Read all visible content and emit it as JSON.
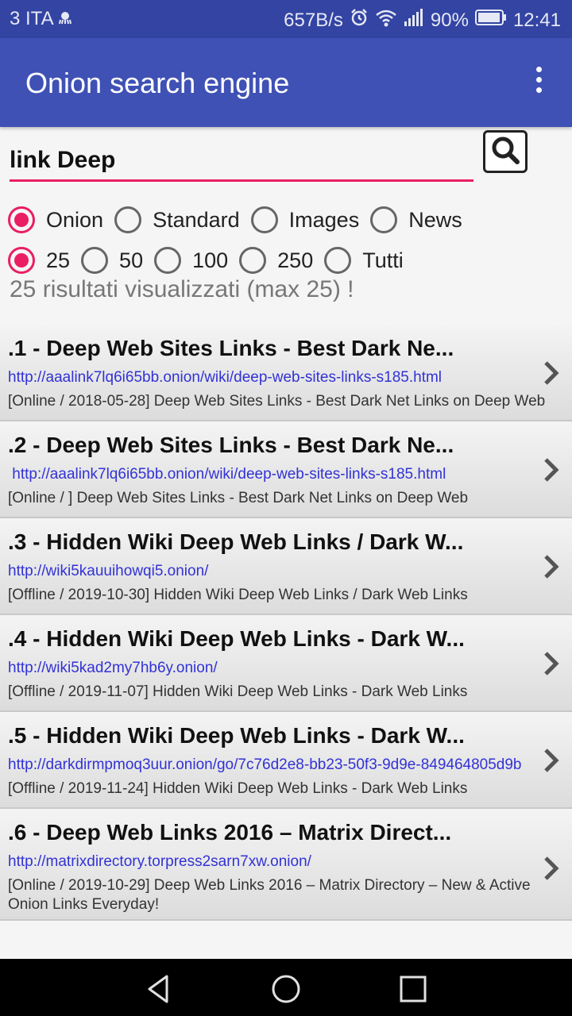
{
  "status_bar": {
    "carrier": "3 ITA",
    "speed": "657B/s",
    "battery": "90%",
    "time": "12:41",
    "icons": [
      "octopus-icon",
      "alarm-icon",
      "wifi-icon",
      "signal-icon",
      "battery-icon"
    ]
  },
  "app_bar": {
    "title": "Onion search engine",
    "menu_icon": "overflow-menu-icon"
  },
  "search": {
    "value": "link Deep",
    "button_icon": "search-icon"
  },
  "engine_options": {
    "items": [
      "Onion",
      "Standard",
      "Images",
      "News"
    ],
    "selected": "Onion"
  },
  "count_options": {
    "items": [
      "25",
      "50",
      "100",
      "250",
      "Tutti"
    ],
    "selected": "25"
  },
  "status_text": "25 risultati visualizzati (max 25) !",
  "results": [
    {
      "title": ".1 - Deep Web Sites Links - Best Dark Ne...",
      "url": "http://aaalink7lq6i65bb.onion/wiki/deep-web-sites-links-s185.html",
      "desc": "[Online / 2018-05-28] Deep Web Sites Links - Best Dark Net Links on Deep Web"
    },
    {
      "title": ".2 - Deep Web Sites Links - Best Dark Ne...",
      "url": " http://aaalink7lq6i65bb.onion/wiki/deep-web-sites-links-s185.html",
      "desc": "[Online / ] Deep Web Sites Links - Best Dark Net Links on Deep Web"
    },
    {
      "title": ".3 - Hidden Wiki Deep Web Links / Dark W...",
      "url": "http://wiki5kauuihowqi5.onion/",
      "desc": "[Offline / 2019-10-30] Hidden Wiki Deep Web Links / Dark Web Links"
    },
    {
      "title": ".4 - Hidden Wiki Deep Web Links - Dark W...",
      "url": "http://wiki5kad2my7hb6y.onion/",
      "desc": "[Offline / 2019-11-07] Hidden Wiki Deep Web Links - Dark Web Links"
    },
    {
      "title": ".5 - Hidden Wiki Deep Web Links - Dark W...",
      "url": "http://darkdirmpmoq3uur.onion/go/7c76d2e8-bb23-50f3-9d9e-849464805d9b",
      "desc": "[Offline / 2019-11-24] Hidden Wiki Deep Web Links - Dark Web Links"
    },
    {
      "title": ".6 - Deep Web Links 2016 – Matrix Direct...",
      "url": "http://matrixdirectory.torpress2sarn7xw.onion/",
      "desc": "[Online / 2019-10-29] Deep Web Links 2016 – Matrix Directory – New & Active Onion Links Everyday!"
    }
  ],
  "nav_bar": {
    "icons": [
      "back-icon",
      "home-icon",
      "recents-icon"
    ]
  },
  "colors": {
    "primary": "#3f51b5",
    "primary_dark": "#3344a3",
    "accent": "#e91e63",
    "link": "#3232d6"
  }
}
